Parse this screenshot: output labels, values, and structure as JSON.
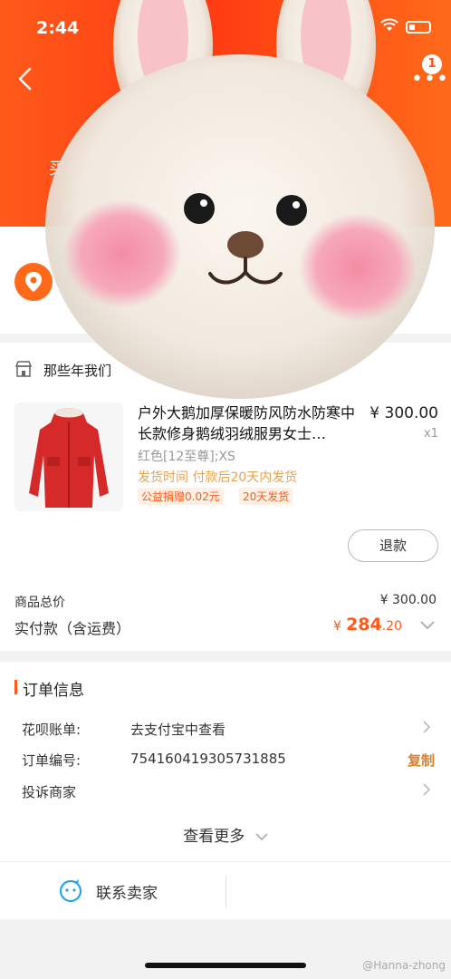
{
  "status_bar": {
    "time": "2:44"
  },
  "header": {
    "title": "买家",
    "badge": "1"
  },
  "address": {
    "line1": "",
    "line2": ""
  },
  "order": {
    "shop_name": "那些年我们",
    "product": {
      "title": "户外大鹅加厚保暖防风防水防寒中长款修身鹅绒羽绒服男女士…",
      "price": "¥ 300.00",
      "qty": "x1",
      "sku": "红色[12至尊];XS",
      "ship_time": "发货时间  付款后20天内发货",
      "tag_charity": "公益捐赠0.02元",
      "tag_days": "20天发货"
    },
    "refund_button": "退款",
    "total_label": "商品总价",
    "total_value": "¥ 300.00",
    "pay_label": "实付款（含运费）",
    "pay_currency": "¥",
    "pay_int": "284",
    "pay_dec": ".20"
  },
  "info": {
    "title": "订单信息",
    "rows": [
      {
        "label": "花呗账单:",
        "value": "去支付宝中查看"
      },
      {
        "label": "订单编号:",
        "value": "754160419305731885"
      },
      {
        "label": "投诉商家",
        "value": ""
      }
    ],
    "copy_label": "复制",
    "see_more": "查看更多",
    "contact_label": "联系卖家"
  },
  "watermark": "@Hanna-zhong",
  "colors": {
    "accent": "#ff5a1a",
    "header": "#ff3a12",
    "copy": "#d9822b"
  }
}
